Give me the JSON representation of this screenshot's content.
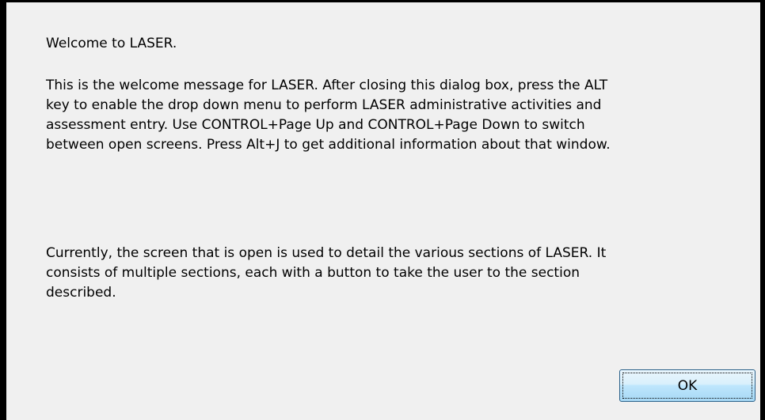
{
  "dialog": {
    "welcome_line": "Welcome to LASER.",
    "paragraph1_lines": [
      "This is the welcome message for LASER. After closing this dialog box, press the ALT",
      "key to enable the drop down menu to perform LASER administrative activities and",
      "assessment entry. Use CONTROL+Page Up and CONTROL+Page Down to switch",
      "between open screens. Press Alt+J to get additional information about that window."
    ],
    "paragraph2_lines": [
      "Currently, the screen that is open is used to detail the various sections of LASER. It",
      "consists of multiple sections, each with a button to take the user to the section",
      "described."
    ],
    "ok_label": "OK"
  }
}
